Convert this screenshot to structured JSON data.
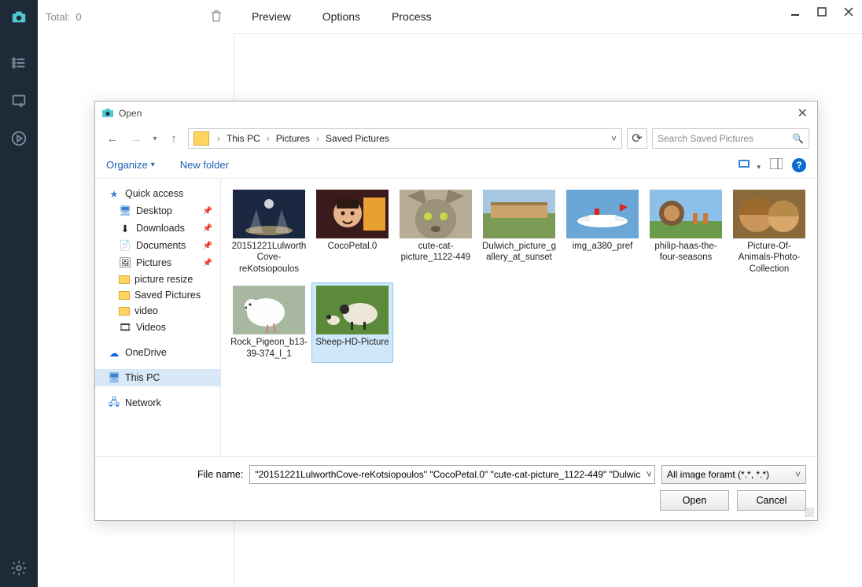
{
  "app": {
    "total_label": "Total:",
    "total_value": "0",
    "tabs": {
      "preview": "Preview",
      "options": "Options",
      "process": "Process"
    }
  },
  "dialog": {
    "title": "Open",
    "breadcrumb": {
      "root": "This PC",
      "p1": "Pictures",
      "p2": "Saved Pictures"
    },
    "search_placeholder": "Search Saved Pictures",
    "toolbar": {
      "organize": "Organize",
      "newfolder": "New folder"
    },
    "tree": {
      "quick": "Quick access",
      "desktop": "Desktop",
      "downloads": "Downloads",
      "documents": "Documents",
      "pictures": "Pictures",
      "pic_resize": "picture resize",
      "saved_pics": "Saved Pictures",
      "video": "video",
      "videos": "Videos",
      "onedrive": "OneDrive",
      "thispc": "This PC",
      "network": "Network"
    },
    "files": [
      {
        "name": "20151221LulworthCove-reKotsiopoulos"
      },
      {
        "name": "CocoPetal.0"
      },
      {
        "name": "cute-cat-picture_1122-449"
      },
      {
        "name": "Dulwich_picture_gallery_at_sunset"
      },
      {
        "name": "img_a380_pref"
      },
      {
        "name": "philip-haas-the-four-seasons"
      },
      {
        "name": "Picture-Of-Animals-Photo-Collection"
      },
      {
        "name": "Rock_Pigeon_b13-39-374_l_1"
      },
      {
        "name": "Sheep-HD-Picture"
      }
    ],
    "filename_label": "File name:",
    "filename_value": "\"20151221LulworthCove-reKotsiopoulos\" \"CocoPetal.0\" \"cute-cat-picture_1122-449\" \"Dulwic",
    "filter_label": "All image foramt (*.*, *.*)",
    "open_btn": "Open",
    "cancel_btn": "Cancel"
  }
}
